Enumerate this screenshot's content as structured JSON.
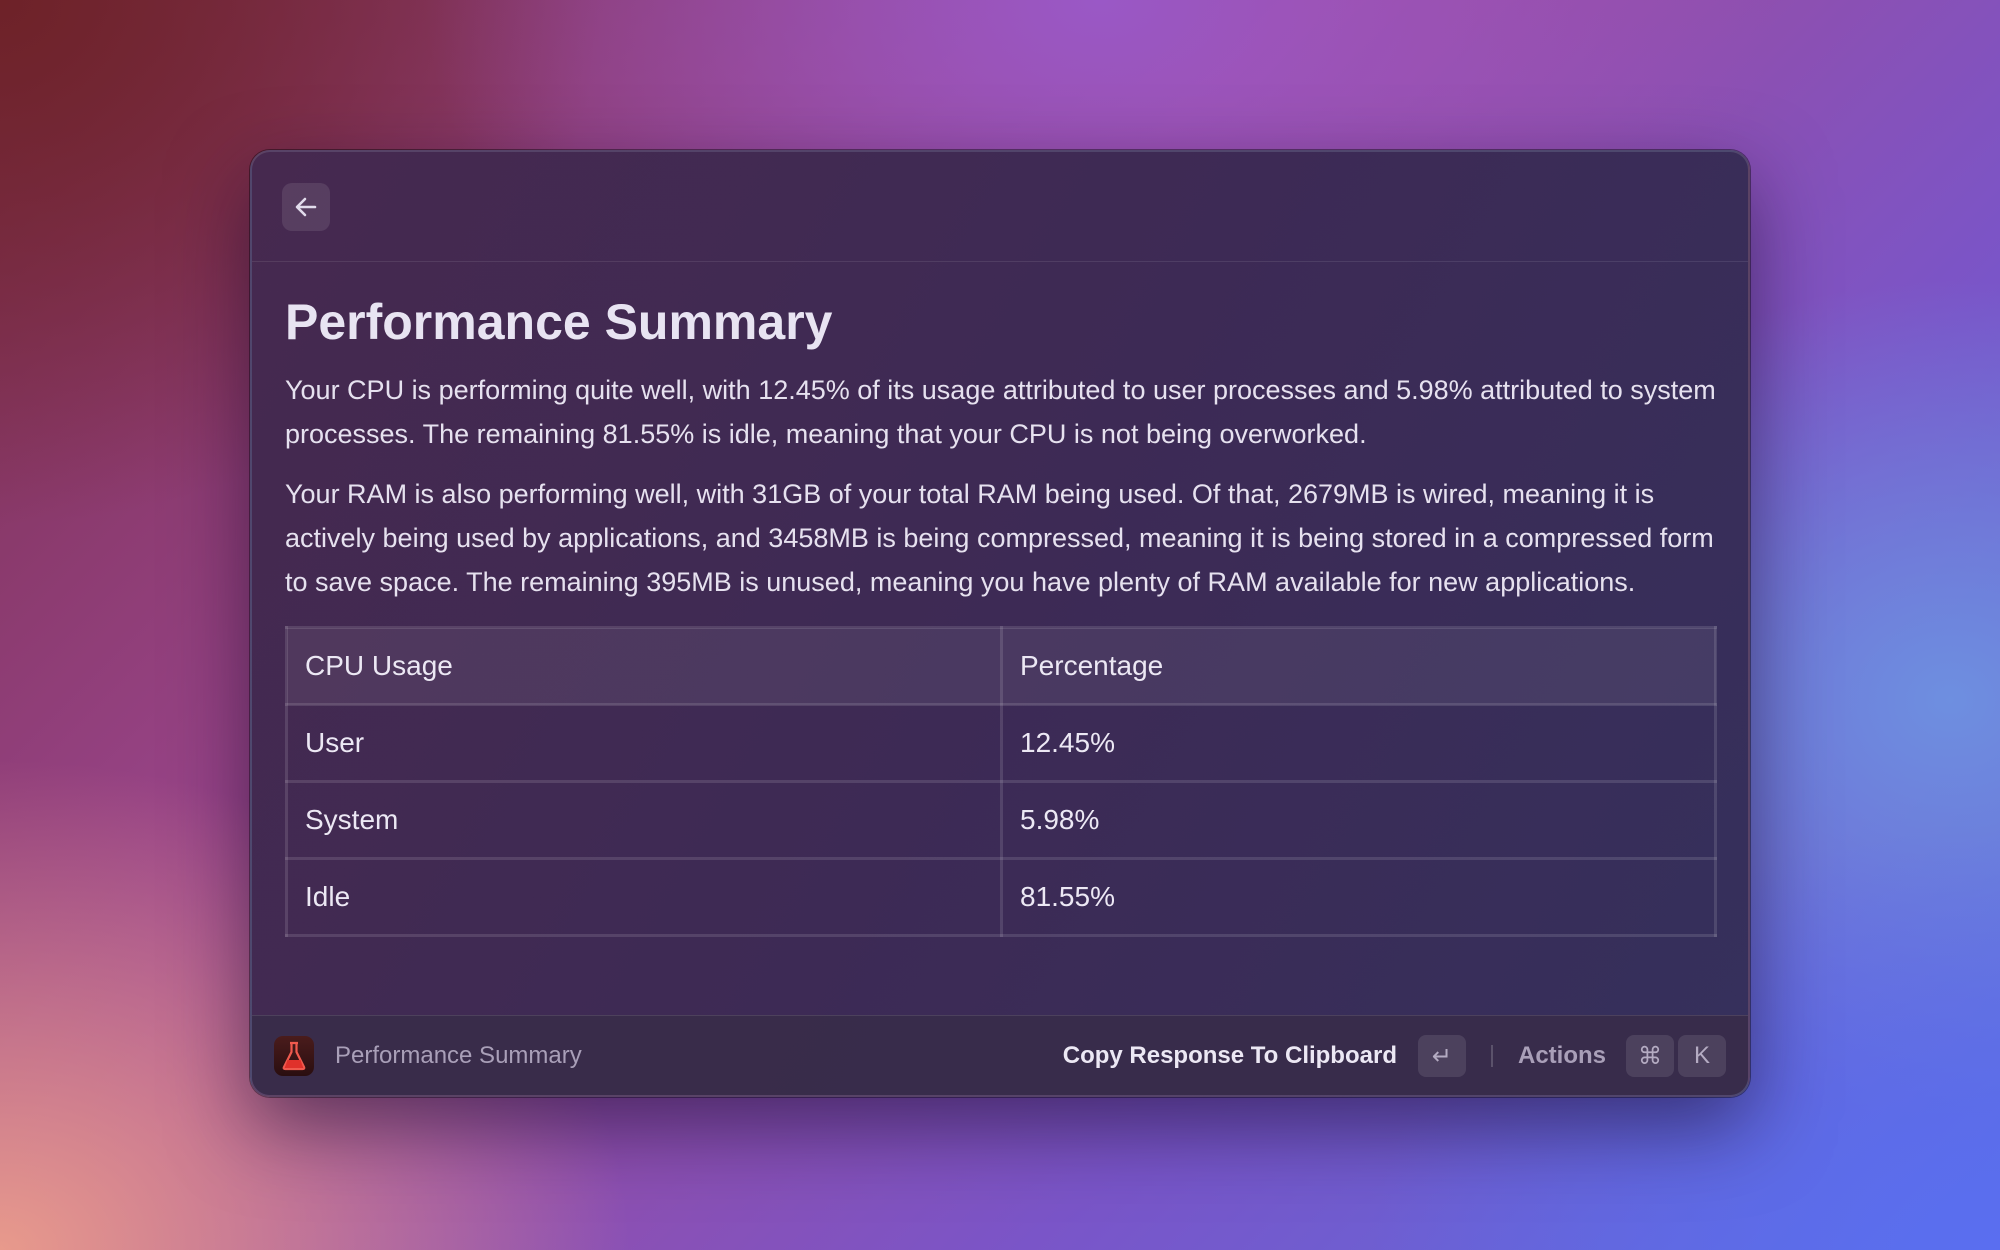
{
  "header": {
    "back_icon": "arrow-left-icon"
  },
  "main": {
    "title": "Performance Summary",
    "paragraphs": [
      "Your CPU is performing quite well, with 12.45% of its usage attributed to user processes and 5.98% attributed to system processes. The remaining 81.55% is idle, meaning that your CPU is not being overworked.",
      "Your RAM is also performing well, with 31GB of your total RAM being used. Of that, 2679MB is wired, meaning it is actively being used by applications, and 3458MB is being compressed, meaning it is being stored in a compressed form to save space. The remaining 395MB is unused, meaning you have plenty of RAM available for new applications."
    ],
    "table": {
      "headers": [
        "CPU Usage",
        "Percentage"
      ],
      "rows": [
        [
          "User",
          "12.45%"
        ],
        [
          "System",
          "5.98%"
        ],
        [
          "Idle",
          "81.55%"
        ]
      ]
    }
  },
  "footer": {
    "app_icon": "flask-icon",
    "title": "Performance Summary",
    "primary_action": "Copy Response To Clipboard",
    "primary_key": "↵",
    "actions_label": "Actions",
    "actions_keys": [
      "⌘",
      "K"
    ]
  },
  "colors": {
    "app_icon_accent": "#e0312b"
  }
}
